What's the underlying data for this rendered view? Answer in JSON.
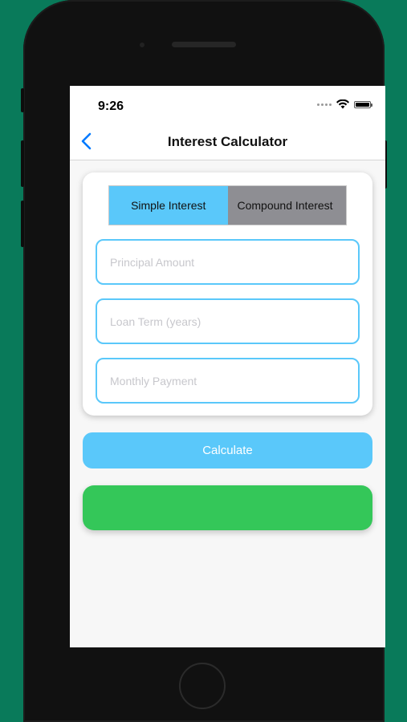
{
  "status_bar": {
    "time": "9:26",
    "icons": [
      "cellular-dots-icon",
      "wifi-icon",
      "battery-icon"
    ]
  },
  "nav": {
    "back_icon": "chevron-left-icon",
    "title": "Interest Calculator"
  },
  "segmented_control": {
    "options": [
      "Simple Interest",
      "Compound Interest"
    ],
    "selected": "Simple Interest"
  },
  "form": {
    "principal_placeholder": "Principal Amount",
    "principal_value": "",
    "term_placeholder": "Loan Term (years)",
    "term_value": "",
    "payment_placeholder": "Monthly Payment",
    "payment_value": ""
  },
  "calculate_label": "Calculate",
  "result_text": "",
  "colors": {
    "background": "#097a5a",
    "accent_blue": "#5ac8fa",
    "segment_inactive": "#8e8e93",
    "result_green": "#34c759",
    "nav_back": "#007aff"
  }
}
